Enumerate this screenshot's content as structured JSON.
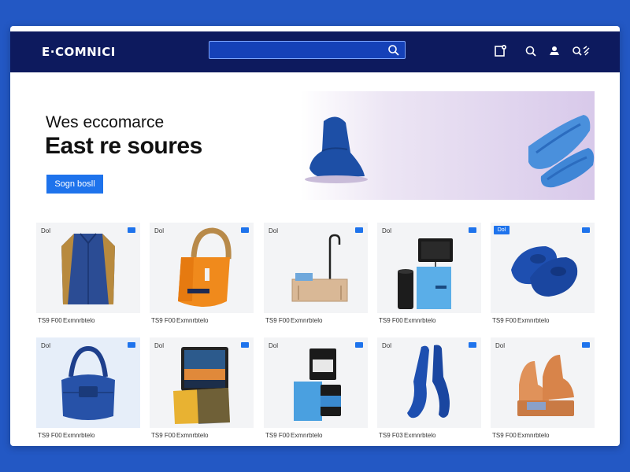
{
  "header": {
    "brand": "E·COMNICI",
    "search": {
      "placeholder": "",
      "value": ""
    },
    "icons": [
      "cart-icon",
      "search-icon",
      "user-icon",
      "search-menu-icon"
    ]
  },
  "hero": {
    "line1": "Wes eccomarce",
    "line2": "East re soures",
    "button": "Sogn bosll"
  },
  "products": [
    {
      "tag": "Dol",
      "price": "TS9 F00",
      "name": "Exmnrbtelo",
      "art": "jacket"
    },
    {
      "tag": "Dol",
      "price": "TS9 F00",
      "name": "Exmnrbtelo",
      "art": "orange-bag"
    },
    {
      "tag": "Dol",
      "price": "TS9 F00",
      "name": "Exmnrbtelo",
      "art": "box"
    },
    {
      "tag": "Dol",
      "price": "TS9 F00",
      "name": "Exmnrbtelo",
      "art": "speaker"
    },
    {
      "tag": "",
      "badge": "Dol",
      "price": "TS9 F00",
      "name": "Exmnrbtelo",
      "art": "shoes"
    },
    {
      "tag": "Dol",
      "price": "TS9 F00",
      "name": "Exmnrbtelo",
      "art": "blue-bag"
    },
    {
      "tag": "Dol",
      "price": "TS9 F00",
      "name": "Exmnrbtelo",
      "art": "tablet"
    },
    {
      "tag": "Dol",
      "price": "TS9 F00",
      "name": "Exmnrbtelo",
      "art": "jars"
    },
    {
      "tag": "Dol",
      "price": "TS9 F03",
      "name": "Exmnrbtelo",
      "art": "socks"
    },
    {
      "tag": "Dol",
      "price": "TS9 F00",
      "name": "Exmnrbtelo",
      "art": "sandals"
    }
  ],
  "colors": {
    "background": "#2358c4",
    "topbar": "#0d1a5e",
    "accent": "#1e73ec"
  }
}
